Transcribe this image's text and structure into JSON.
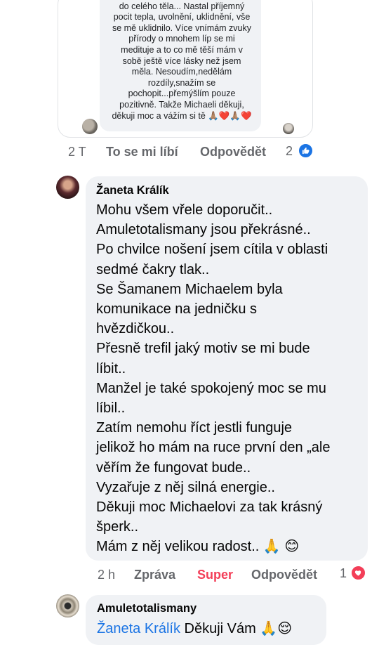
{
  "prev_comment": {
    "screenshot_text": "které se po pár hodinách rozlévalo\ndo celého těla... Nastal příjemný\npocit tepla, uvolnění, uklidnění, vše\nse mě uklidnilo. Více vnímám zvuky\npřírody o mnohem líp se mi\nmedituje a to co mě těší mám v\nsobě ještě více lásky než jsem\nměla. Nesoudím,nedělám\nrozdíly,snažím se\npochopit...přemýšlím pouze\npozitivně. Takže Michaeli děkuji,\nděkuji moc a vážím si tě 🙏🏽❤️🙏🏽❤️",
    "time": "2 T",
    "like_label": "To se mi líbí",
    "reply_label": "Odpovědět",
    "reaction_count": "2"
  },
  "comment": {
    "author": "Žaneta Králík",
    "text": "Mohu všem vřele doporučit..\nAmuletotalismany jsou překrásné..\nPo chvilce nošení jsem cítila v oblasti\nsedmé čakry tlak..\nSe Šamanem Michaelem byla\nkomunikace na jedničku s\nhvězdičkou..\nPřesně trefil jaký motiv se mi bude\nlíbit..\nManžel je také spokojený moc se mu\nlíbil..\nZatím nemohu říct jestli funguje\njelikož ho mám na ruce první den „ale\nvěřím že fungovat bude..\nVyzařuje z něj silná energie..\nDěkuji moc Michaelovi za tak krásný\nšperk..\nMám z něj velikou radost.. 🙏 😊",
    "time": "2 h",
    "message_label": "Zpráva",
    "reaction_label": "Super",
    "reply_label": "Odpovědět",
    "reaction_count": "1",
    "reaction_color": "#f33e58"
  },
  "reply": {
    "author": "Amuletotalismany",
    "mention": "Žaneta Králík",
    "text": " Děkuji Vám 🙏😌"
  },
  "icons": {
    "like": "thumbs-up-icon",
    "love": "heart-icon"
  },
  "colors": {
    "link": "#1b74e4",
    "like_blue": "#1b74e4",
    "love_red": "#f33e58",
    "muted": "#65676b",
    "bubble": "#f0f2f5"
  }
}
